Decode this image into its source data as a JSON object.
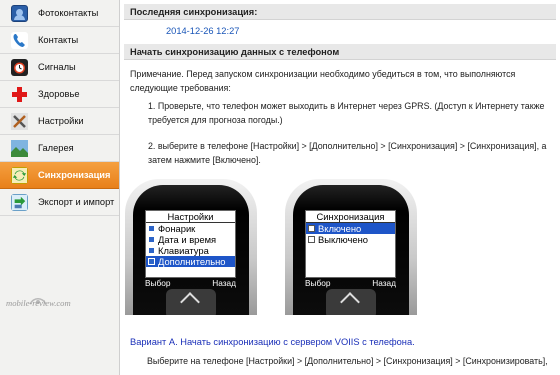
{
  "sidebar": {
    "items": [
      {
        "label": "Фотоконтакты",
        "icon": "photo-contacts-icon"
      },
      {
        "label": "Контакты",
        "icon": "phone-handset-icon"
      },
      {
        "label": "Сигналы",
        "icon": "alarm-clock-icon"
      },
      {
        "label": "Здоровье",
        "icon": "red-cross-icon"
      },
      {
        "label": "Настройки",
        "icon": "tools-icon"
      },
      {
        "label": "Галерея",
        "icon": "gallery-icon"
      },
      {
        "label": "Синхронизация",
        "icon": "sync-icon",
        "active": true
      },
      {
        "label": "Экспорт и импорт",
        "icon": "export-import-icon"
      }
    ],
    "active_color": "#f0901e"
  },
  "main": {
    "last_sync_header": "Последняя синхронизация:",
    "last_sync_value": "2014-12-26 12:27",
    "start_header": "Начать синхронизацию данных с телефоном",
    "note": "Примечание. Перед запуском синхронизации необходимо убедиться в том, что выполняются следующие требования:",
    "step1": "1. Проверьте, что телефон может выходить в Интернет через GPRS. (Доступ к Интернету также требуется для прогноза погоды.)",
    "step2": "2. выберите в телефоне [Настройки] > [Дополнительно] > [Синхронизация] > [Синхронизация], а затем нажмите [Включено].",
    "phone1": {
      "title": "Настройки",
      "items": [
        {
          "label": "Фонарик",
          "selected": false
        },
        {
          "label": "Дата и время",
          "selected": false
        },
        {
          "label": "Клавиатура",
          "selected": false
        },
        {
          "label": "Дополнительно",
          "selected": true
        }
      ],
      "soft_left": "Выбор",
      "soft_right": "Назад"
    },
    "phone2": {
      "title": "Синхронизация",
      "items": [
        {
          "label": "Включено",
          "selected": true,
          "checked": true
        },
        {
          "label": "Выключено",
          "selected": false,
          "checked": false
        }
      ],
      "soft_left": "Выбор",
      "soft_right": "Назад"
    },
    "watermark": "mobile-review.com",
    "variant_title": "Вариант А. Начать синхронизацию с сервером VOIIS с телефона.",
    "variant_step": "Выберите на телефоне [Настройки] > [Дополнительно] > [Синхронизация] > [Синхронизировать],"
  },
  "colors": {
    "link_blue": "#1a56b8",
    "variant_blue": "#1a2fb8",
    "selection_blue": "#1e55c8"
  }
}
